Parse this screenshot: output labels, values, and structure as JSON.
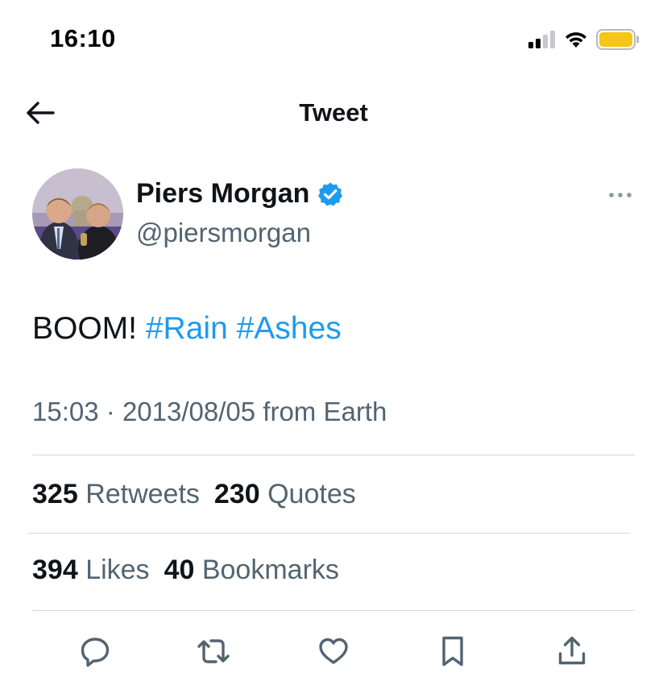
{
  "status_bar": {
    "time": "16:10",
    "icons": [
      "cellular-signal-icon",
      "wifi-icon",
      "battery-icon"
    ],
    "battery_color": "#f5c518"
  },
  "nav": {
    "title": "Tweet",
    "back_icon": "arrow-left-icon"
  },
  "tweet": {
    "author": {
      "display_name": "Piers Morgan",
      "username": "@piersmorgan",
      "verified": true,
      "verified_color": "#1d9bf0"
    },
    "text": "BOOM!",
    "hashtags": [
      "#Rain",
      "#Ashes"
    ],
    "time": "15:03",
    "separator": "·",
    "date": "2013/08/05",
    "source": "from Earth"
  },
  "stats": {
    "retweets_count": "325",
    "retweets_label": "Retweets",
    "quotes_count": "230",
    "quotes_label": "Quotes",
    "likes_count": "394",
    "likes_label": "Likes",
    "bookmarks_count": "40",
    "bookmarks_label": "Bookmarks"
  },
  "actions": [
    "reply-icon",
    "retweet-icon",
    "like-icon",
    "bookmark-icon",
    "share-icon"
  ],
  "colors": {
    "text_primary": "#0f1419",
    "text_secondary": "#536471",
    "accent": "#1d9bf0",
    "divider": "#cfd9de"
  }
}
